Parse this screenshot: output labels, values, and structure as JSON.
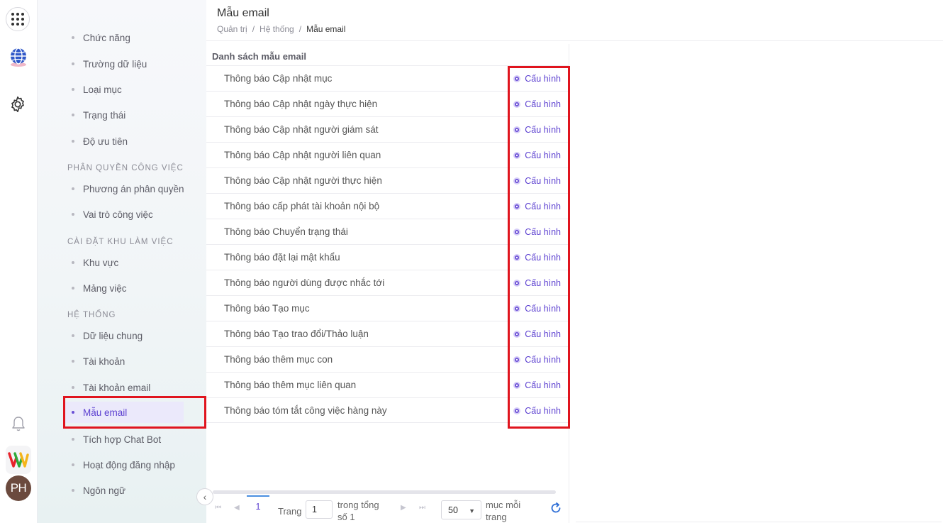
{
  "header": {
    "title": "Mẫu email",
    "breadcrumb": [
      "Quản trị",
      "Hệ thống",
      "Mẫu email"
    ]
  },
  "rail": {
    "avatar_initials": "PH",
    "icons": [
      "apps-grid-icon",
      "globe-icon",
      "settings-gear-icon",
      "bell-icon",
      "brand-logo-icon"
    ]
  },
  "sidebar": {
    "items_top": [
      "Chức năng",
      "Trường dữ liệu",
      "Loại mục",
      "Trạng thái",
      "Độ ưu tiên"
    ],
    "section_permissions": "PHÂN QUYỀN CÔNG VIỆC",
    "items_permissions": [
      "Phương án phân quyền",
      "Vai trò công việc"
    ],
    "section_workspace": "CÀI ĐẶT KHU LÀM VIỆC",
    "items_workspace": [
      "Khu vực",
      "Mảng việc"
    ],
    "section_system": "HỆ THỐNG",
    "items_system": [
      "Dữ liệu chung",
      "Tài khoản",
      "Tài khoản email",
      "Mẫu email",
      "Tích hợp Chat Bot",
      "Hoạt động đăng nhập",
      "Ngôn ngữ"
    ],
    "active_item": "Mẫu email",
    "collapse_glyph": "‹"
  },
  "list": {
    "title": "Danh sách mẫu email",
    "config_label": "Cấu hình",
    "rows": [
      "Thông báo Cập nhật mục",
      "Thông báo Cập nhật ngày thực hiện",
      "Thông báo Cập nhật người giám sát",
      "Thông báo Cập nhật người liên quan",
      "Thông báo Cập nhật người thực hiện",
      "Thông báo cấp phát tài khoản nội bộ",
      "Thông báo Chuyển trạng thái",
      "Thông báo đặt lại mật khẩu",
      "Thông báo người dùng được nhắc tới",
      "Thông báo Tạo mục",
      "Thông báo Tạo trao đổi/Thảo luận",
      "Thông báo thêm mục con",
      "Thông báo thêm mục liên quan",
      "Thông báo tóm tắt công việc hàng này"
    ]
  },
  "pager": {
    "current_page": "1",
    "page_label": "Trang",
    "page_input_value": "1",
    "total_label_line1": "trong tổng",
    "total_label_line2": "số 1",
    "page_size": "50",
    "per_page_label_line1": "mục mỗi",
    "per_page_label_line2": "trang",
    "first_glyph": "⏮",
    "prev_glyph": "◀",
    "next_glyph": "▶",
    "last_glyph": "⏭",
    "caret_glyph": "▼"
  },
  "colors": {
    "accent": "#5b3fd0",
    "highlight": "#e0141e",
    "active_bg": "#ebe9fb"
  }
}
